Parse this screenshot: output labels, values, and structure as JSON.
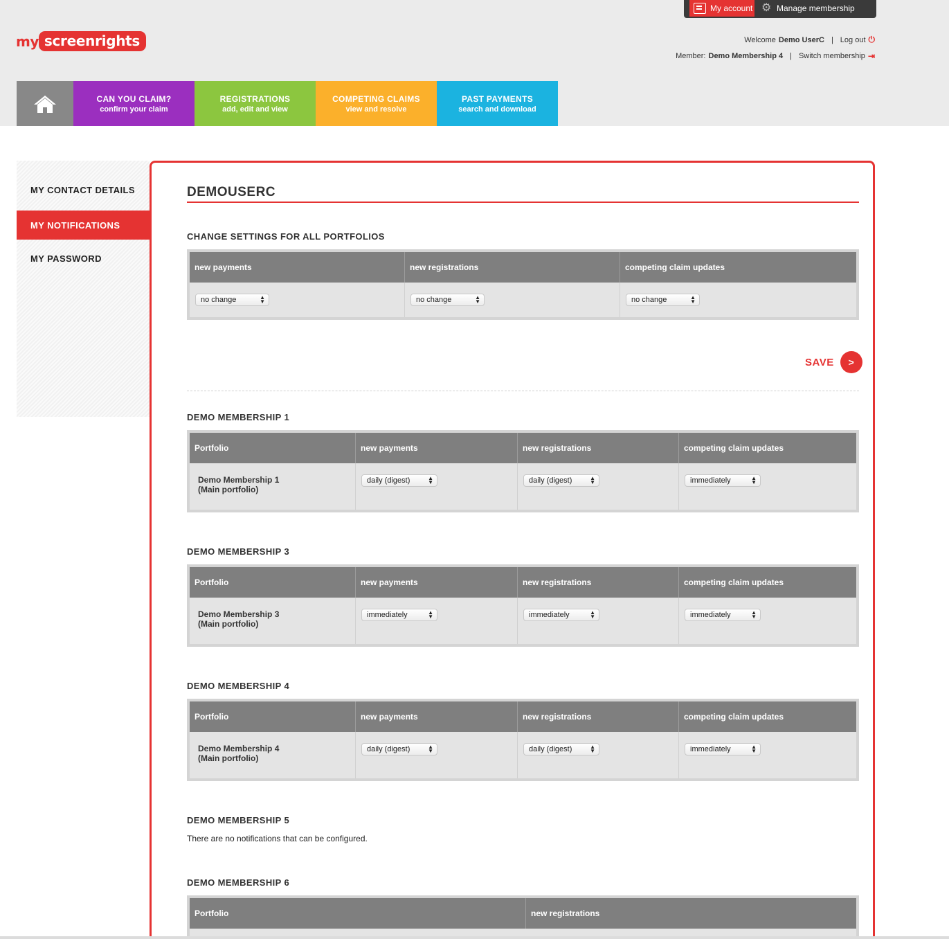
{
  "topbar": {
    "my_account": "My account",
    "manage_membership": "Manage membership"
  },
  "logo": {
    "part1": "my",
    "part2": "screenrights"
  },
  "account": {
    "welcome_label": "Welcome",
    "user_name": "Demo UserC",
    "logout": "Log out",
    "member_label": "Member:",
    "member_name": "Demo Membership 4",
    "switch": "Switch membership"
  },
  "nav": {
    "tabs": [
      {
        "title": "CAN YOU CLAIM?",
        "subtitle": "confirm your claim",
        "color": "#9b2fbf"
      },
      {
        "title": "REGISTRATIONS",
        "subtitle": "add, edit and view",
        "color": "#8cc63f"
      },
      {
        "title": "COMPETING CLAIMS",
        "subtitle": "view and resolve",
        "color": "#fbb02b"
      },
      {
        "title": "PAST PAYMENTS",
        "subtitle": "search and download",
        "color": "#1bb3e0"
      }
    ]
  },
  "sidebar": {
    "items": [
      {
        "label": "MY CONTACT DETAILS"
      },
      {
        "label": "MY NOTIFICATIONS",
        "active": true
      },
      {
        "label": "MY PASSWORD"
      }
    ]
  },
  "main": {
    "username": "DEMOUSERC",
    "all_portfolios": {
      "title": "CHANGE SETTINGS FOR ALL PORTFOLIOS",
      "headers": [
        "new payments",
        "new registrations",
        "competing claim updates"
      ],
      "values": [
        "no change",
        "no change",
        "no change"
      ]
    },
    "save_label": "SAVE",
    "memberships": [
      {
        "title": "DEMO MEMBERSHIP 1",
        "headers": [
          "Portfolio",
          "new payments",
          "new registrations",
          "competing claim updates"
        ],
        "portfolio": [
          "Demo Membership 1",
          "(Main portfolio)"
        ],
        "values": [
          "daily (digest)",
          "daily (digest)",
          "immediately"
        ]
      },
      {
        "title": "DEMO MEMBERSHIP 3",
        "headers": [
          "Portfolio",
          "new payments",
          "new registrations",
          "competing claim updates"
        ],
        "portfolio": [
          "Demo Membership 3",
          "(Main portfolio)"
        ],
        "values": [
          "immediately",
          "immediately",
          "immediately"
        ]
      },
      {
        "title": "DEMO MEMBERSHIP 4",
        "headers": [
          "Portfolio",
          "new payments",
          "new registrations",
          "competing claim updates"
        ],
        "portfolio": [
          "Demo Membership 4",
          "(Main portfolio)"
        ],
        "values": [
          "daily (digest)",
          "daily (digest)",
          "immediately"
        ]
      },
      {
        "title": "DEMO MEMBERSHIP 5",
        "note": "There are no notifications that can be configured."
      },
      {
        "title": "DEMO MEMBERSHIP 6",
        "headers": [
          "Portfolio",
          "new registrations"
        ]
      }
    ]
  },
  "colors": {
    "accent": "#e53332",
    "table_header": "#7f7f7f",
    "home_tab": "#888888"
  }
}
